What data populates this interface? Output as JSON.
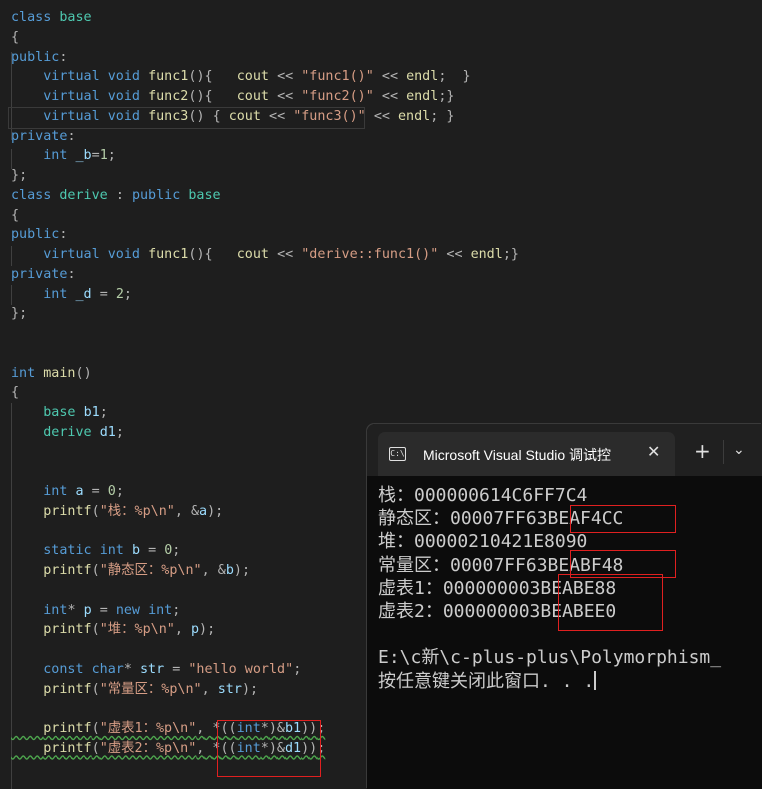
{
  "editor": {
    "lines": [
      "class base",
      "{",
      "public:",
      "    virtual void func1(){   cout << \"func1()\" << endl;  }",
      "    virtual void func2(){   cout << \"func2()\" << endl;}",
      "    virtual void func3() { cout << \"func3()\" << endl; }",
      "private:",
      "    int _b=1;",
      "};",
      "class derive : public base",
      "{",
      "public:",
      "    virtual void func1(){   cout << \"derive::func1()\" << endl;}",
      "private:",
      "    int _d = 2;",
      "};",
      "",
      "",
      "int main()",
      "{",
      "    base b1;",
      "    derive d1;",
      "",
      "",
      "    int a = 0;",
      "    printf(\"栈：%p\\n\", &a);",
      "",
      "    static int b = 0;",
      "    printf(\"静态区：%p\\n\", &b);",
      "",
      "    int* p = new int;",
      "    printf(\"堆：%p\\n\", p);",
      "",
      "    const char* str = \"hello world\";",
      "    printf(\"常量区：%p\\n\", str);",
      "",
      "    printf(\"虚表1：%p\\n\", *((int*)&b1));",
      "    printf(\"虚表2：%p\\n\", *((int*)&d1));"
    ]
  },
  "console": {
    "tab_title": "Microsoft Visual Studio 调试控",
    "tab_icon": "C:\\",
    "close_glyph": "✕",
    "new_tab_glyph": "+",
    "dropdown_glyph": "⌄",
    "output": [
      "栈：000000614C6FF7C4",
      "静态区：00007FF63BEAF4CC",
      "堆：00000210421E8090",
      "常量区：00007FF63BEABF48",
      "虚表1：000000003BEABE88",
      "虚表2：000000003BEABEE0",
      "",
      "E:\\c新\\c-plus-plus\\Polymorphism_",
      "按任意键关闭此窗口. . ."
    ]
  },
  "colors": {
    "editor_bg": "#1e1e1e",
    "keyword": "#569cd6",
    "type": "#4ec9b0",
    "function": "#dcdcaa",
    "string": "#d69d85",
    "highlight_box": "#e02020",
    "console_bg": "#0c0c0c"
  }
}
